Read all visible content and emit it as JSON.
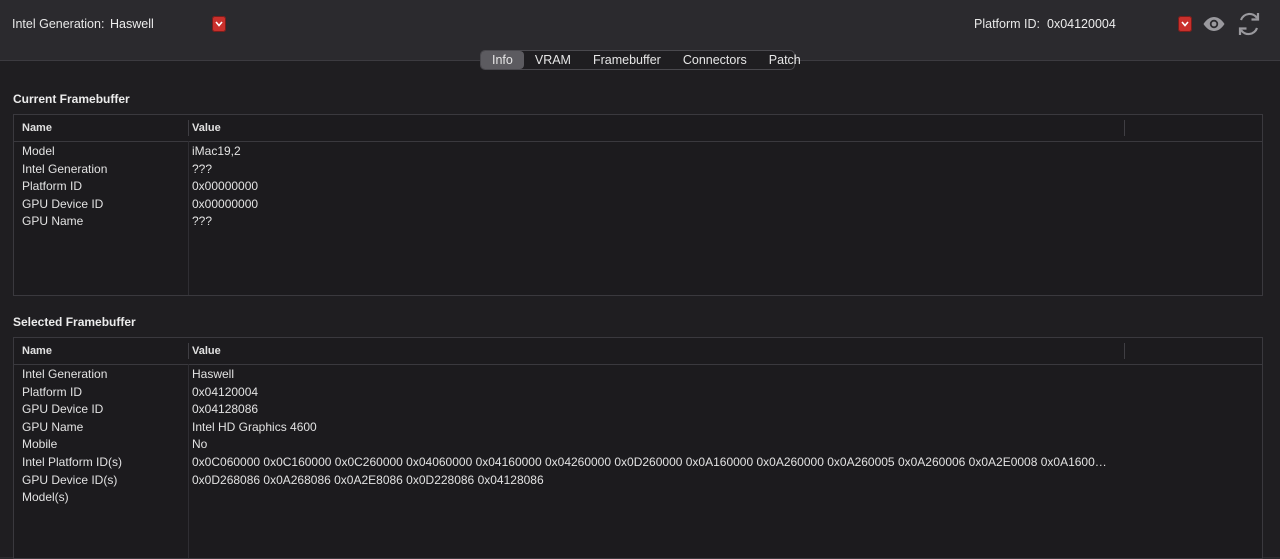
{
  "toolbar": {
    "generation_label": "Intel Generation:",
    "generation_value": "Haswell",
    "platform_label": "Platform ID:",
    "platform_value": "0x04120004",
    "eye_icon": "eye-icon",
    "refresh_icon": "refresh-icon",
    "accent_color": "#c9302c"
  },
  "tabs": [
    {
      "label": "Info",
      "active": true
    },
    {
      "label": "VRAM",
      "active": false
    },
    {
      "label": "Framebuffer",
      "active": false
    },
    {
      "label": "Connectors",
      "active": false
    },
    {
      "label": "Patch",
      "active": false
    }
  ],
  "current": {
    "title": "Current Framebuffer",
    "col_name": "Name",
    "col_value": "Value",
    "rows": [
      {
        "name": "Model",
        "value": "iMac19,2"
      },
      {
        "name": "Intel Generation",
        "value": "???"
      },
      {
        "name": "Platform ID",
        "value": "0x00000000"
      },
      {
        "name": "GPU Device ID",
        "value": "0x00000000"
      },
      {
        "name": "GPU Name",
        "value": "???"
      }
    ]
  },
  "selected": {
    "title": "Selected Framebuffer",
    "col_name": "Name",
    "col_value": "Value",
    "rows": [
      {
        "name": "Intel Generation",
        "value": "Haswell"
      },
      {
        "name": "Platform ID",
        "value": "0x04120004"
      },
      {
        "name": "GPU Device ID",
        "value": "0x04128086"
      },
      {
        "name": "GPU Name",
        "value": "Intel HD Graphics 4600"
      },
      {
        "name": "Mobile",
        "value": "No"
      },
      {
        "name": "Intel Platform ID(s)",
        "value": "0x0C060000 0x0C160000 0x0C260000 0x04060000 0x04160000 0x04260000 0x0D260000 0x0A160000 0x0A260000 0x0A260005 0x0A260006 0x0A2E0008 0x0A1600…"
      },
      {
        "name": "GPU Device ID(s)",
        "value": "0x0D268086 0x0A268086 0x0A2E8086 0x0D228086 0x04128086"
      },
      {
        "name": "Model(s)",
        "value": ""
      }
    ]
  }
}
